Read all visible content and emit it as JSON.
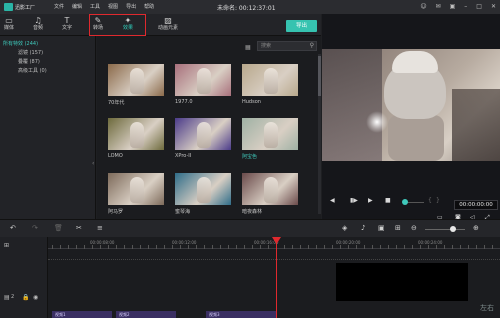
{
  "titlebar": {
    "app_name": "迅影工厂",
    "menu": [
      "文件",
      "编辑",
      "工具",
      "视图",
      "导出",
      "帮助"
    ],
    "doc_title": "未命名: 00:12:37:01"
  },
  "toolbar": {
    "tools": [
      {
        "label": "媒体",
        "icon": "folder-icon"
      },
      {
        "label": "音频",
        "icon": "music-icon"
      },
      {
        "label": "文字",
        "icon": "text-icon"
      },
      {
        "label": "转场",
        "icon": "transition-icon"
      },
      {
        "label": "效果",
        "icon": "effects-icon"
      },
      {
        "label": "动画元素",
        "icon": "image-icon"
      }
    ],
    "export_label": "导出"
  },
  "leftpanel": {
    "items": [
      {
        "label": "所有特效 (244)",
        "selected": true
      },
      {
        "label": "滤镜 (157)",
        "selected": false
      },
      {
        "label": "叠覆 (87)",
        "selected": false
      },
      {
        "label": "高级工具 (0)",
        "selected": false
      }
    ]
  },
  "media": {
    "search_placeholder": "搜索",
    "thumbnails": [
      {
        "label": "70年代",
        "tone": "#8b6a4a"
      },
      {
        "label": "1977.0",
        "tone": "#a8707c"
      },
      {
        "label": "Hudson",
        "tone": "#b8a88c"
      },
      {
        "label": "LOMO",
        "tone": "#6d6a3c"
      },
      {
        "label": "XPro-II",
        "tone": "#4b3b8a"
      },
      {
        "label": "阿宝色",
        "tone": "#9fb1a4",
        "highlight": true
      },
      {
        "label": "阿马罗",
        "tone": "#7d6a5a"
      },
      {
        "label": "蜜琴海",
        "tone": "#2f6d89"
      },
      {
        "label": "暗夜森林",
        "tone": "#6a4a4a"
      }
    ]
  },
  "preview": {
    "timecode": "00:00:00:00"
  },
  "timeline": {
    "ruler": [
      "00:00:00:00",
      "00:00:08:00",
      "00:00:12:00",
      "00:00:16:00",
      "00:00:20:00",
      "00:00:24:00"
    ],
    "track_label": "2",
    "clips": [
      "视频1",
      "视频2",
      "视频3"
    ],
    "watermark": "左右"
  }
}
